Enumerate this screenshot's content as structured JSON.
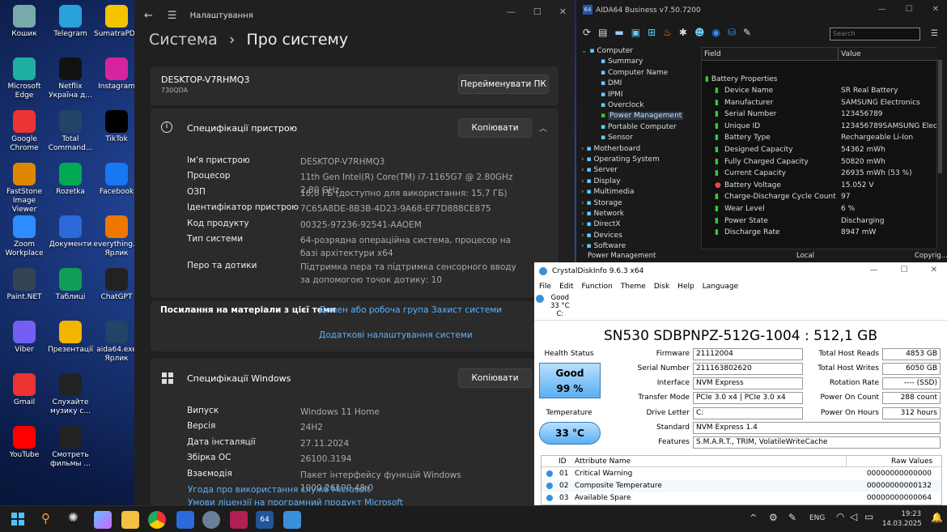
{
  "desktop_icons": [
    {
      "label": "Кошик",
      "color": "#7aa"
    },
    {
      "label": "Telegram",
      "color": "#2aa1da"
    },
    {
      "label": "SumatraPDF",
      "color": "#f5c400"
    },
    {
      "label": "Microsoft Edge",
      "color": "#1db0a0"
    },
    {
      "label": "Netflix Україна д...",
      "color": "#111"
    },
    {
      "label": "Instagram",
      "color": "#d6249f"
    },
    {
      "label": "Google Chrome",
      "color": "#e33"
    },
    {
      "label": "Total Command...",
      "color": "#246"
    },
    {
      "label": "TikTok",
      "color": "#000"
    },
    {
      "label": "FastStone Image Viewer",
      "color": "#d80"
    },
    {
      "label": "Rozetka",
      "color": "#0a5"
    },
    {
      "label": "Facebook",
      "color": "#1877f2"
    },
    {
      "label": "Zoom Workplace",
      "color": "#2d8cff"
    },
    {
      "label": "Документи",
      "color": "#2b6ad8"
    },
    {
      "label": "everything... Ярлик",
      "color": "#e70"
    },
    {
      "label": "Paint.NET",
      "color": "#345"
    },
    {
      "label": "Таблиці",
      "color": "#0f9d58"
    },
    {
      "label": "ChatGPT",
      "color": "#222"
    },
    {
      "label": "Viber",
      "color": "#7360f2"
    },
    {
      "label": "Презентації",
      "color": "#f4b400"
    },
    {
      "label": "aida64.exe Ярлик",
      "color": "#246"
    },
    {
      "label": "Gmail",
      "color": "#e33"
    },
    {
      "label": "Слухайте музику с...",
      "color": "#222"
    },
    {
      "label": "",
      "color": "transparent"
    },
    {
      "label": "YouTube",
      "color": "#f00"
    },
    {
      "label": "Смотреть фильмы ...",
      "color": "#222"
    },
    {
      "label": "",
      "color": "transparent"
    }
  ],
  "settings": {
    "title": "Налаштування",
    "breadcrumb_root": "Система",
    "breadcrumb_sep": "›",
    "page_title": "Про систему",
    "device_name": "DESKTOP-V7RHMQ3",
    "device_model": "730QDA",
    "rename_button": "Перейменувати ПК",
    "device_specs_title": "Специфікації пристрою",
    "copy_button": "Копіювати",
    "device_specs": [
      {
        "k": "Ім'я пристрою",
        "v": "DESKTOP-V7RHMQ3"
      },
      {
        "k": "Процесор",
        "v": "11th Gen Intel(R) Core(TM) i7-1165G7 @ 2.80GHz   2.80 GHz"
      },
      {
        "k": "ОЗП",
        "v": "16,0 ГБ (доступно для використання: 15,7 ГБ)"
      },
      {
        "k": "Ідентифікатор пристрою",
        "v": "7C65A8DE-8B3B-4D23-9A68-EF7D888CE875"
      },
      {
        "k": "Код продукту",
        "v": "00325-97236-92541-AAOEM"
      },
      {
        "k": "Тип системи",
        "v": "64-розрядна операційна система, процесор на базі архітектури x64"
      },
      {
        "k": "Перо та дотики",
        "v": "Підтримка пера та підтримка сенсорного вводу за допомогою точок дотику: 10"
      }
    ],
    "related_label": "Посилання на матеріали з цієї теми",
    "link_domain": "Домен або робоча група",
    "link_protection": "Захист системи",
    "link_advanced": "Додаткові налаштування системи",
    "windows_specs_title": "Специфікації Windows",
    "windows_specs": [
      {
        "k": "Випуск",
        "v": "Windows 11 Home"
      },
      {
        "k": "Версія",
        "v": "24H2"
      },
      {
        "k": "Дата інсталяції",
        "v": "27.11.2024"
      },
      {
        "k": "Збірка ОС",
        "v": "26100.3194"
      },
      {
        "k": "Взаємодія",
        "v": "Пакет інтерфейсу функцій Windows 1000.26100.48.0"
      }
    ],
    "link_services": "Угода про використання служб Microsoft",
    "link_license": "Умови ліцензії на програмний продукт Microsoft"
  },
  "aida": {
    "title": "AIDA64 Business v7.50.7200",
    "search_placeholder": "Search",
    "col_field": "Field",
    "col_value": "Value",
    "tree": [
      "Computer",
      "Summary",
      "Computer Name",
      "DMI",
      "IPMI",
      "Overclock",
      "Power Management",
      "Portable Computer",
      "Sensor",
      "Motherboard",
      "Operating System",
      "Server",
      "Display",
      "Multimedia",
      "Storage",
      "Network",
      "DirectX",
      "Devices",
      "Software"
    ],
    "section": "Battery Properties",
    "rows": [
      {
        "k": "Device Name",
        "v": "SR Real Battery"
      },
      {
        "k": "Manufacturer",
        "v": "SAMSUNG Electronics"
      },
      {
        "k": "Serial Number",
        "v": "123456789"
      },
      {
        "k": "Unique ID",
        "v": "123456789SAMSUNG Electror"
      },
      {
        "k": "Battery Type",
        "v": "Rechargeable Li-Ion"
      },
      {
        "k": "Designed Capacity",
        "v": "54362 mWh"
      },
      {
        "k": "Fully Charged Capacity",
        "v": "50820 mWh"
      },
      {
        "k": "Current Capacity",
        "v": "26935 mWh  (53 %)"
      },
      {
        "k": "Battery Voltage",
        "v": "15.052 V"
      },
      {
        "k": "Charge-Discharge Cycle Count",
        "v": "97"
      },
      {
        "k": "Wear Level",
        "v": "6 %"
      },
      {
        "k": "Power State",
        "v": "Discharging"
      },
      {
        "k": "Discharge Rate",
        "v": "8947 mW"
      }
    ],
    "status_left": "Power Management",
    "status_mid": "Local",
    "status_right": "Copyrig..."
  },
  "crystal": {
    "title": "CrystalDiskInfo 9.6.3 x64",
    "menu": [
      "File",
      "Edit",
      "Function",
      "Theme",
      "Disk",
      "Help",
      "Language"
    ],
    "disk_tab_status": "Good",
    "disk_tab_temp": "33 °C",
    "disk_tab_letter": "C:",
    "model": "SN530 SDBPNPZ-512G-1004 : 512,1 GB",
    "health_label": "Health Status",
    "health_status": "Good",
    "health_pct": "99 %",
    "temp_label": "Temperature",
    "temp_value": "33 °C",
    "firmware_label": "Firmware",
    "firmware": "21112004",
    "serial_label": "Serial Number",
    "serial": "211163802620",
    "interface_label": "Interface",
    "interface": "NVM Express",
    "transfer_label": "Transfer Mode",
    "transfer": "PCIe 3.0 x4 | PCIe 3.0 x4",
    "letter_label": "Drive Letter",
    "letter": "C:",
    "standard_label": "Standard",
    "standard": "NVM Express 1.4",
    "features_label": "Features",
    "features": "S.M.A.R.T., TRIM, VolatileWriteCache",
    "reads_label": "Total Host Reads",
    "reads": "4853 GB",
    "writes_label": "Total Host Writes",
    "writes": "6050 GB",
    "rotation_label": "Rotation Rate",
    "rotation": "---- (SSD)",
    "pcount_label": "Power On Count",
    "pcount": "288 count",
    "phours_label": "Power On Hours",
    "phours": "312 hours",
    "table_headers": {
      "id": "ID",
      "name": "Attribute Name",
      "raw": "Raw Values"
    },
    "attributes": [
      {
        "id": "01",
        "name": "Critical Warning",
        "raw": "00000000000000"
      },
      {
        "id": "02",
        "name": "Composite Temperature",
        "raw": "00000000000132"
      },
      {
        "id": "03",
        "name": "Available Spare",
        "raw": "00000000000064"
      }
    ]
  },
  "taskbar": {
    "lang": "ENG",
    "time": "19:23",
    "date": "14.03.2025",
    "aida_label": "64"
  }
}
